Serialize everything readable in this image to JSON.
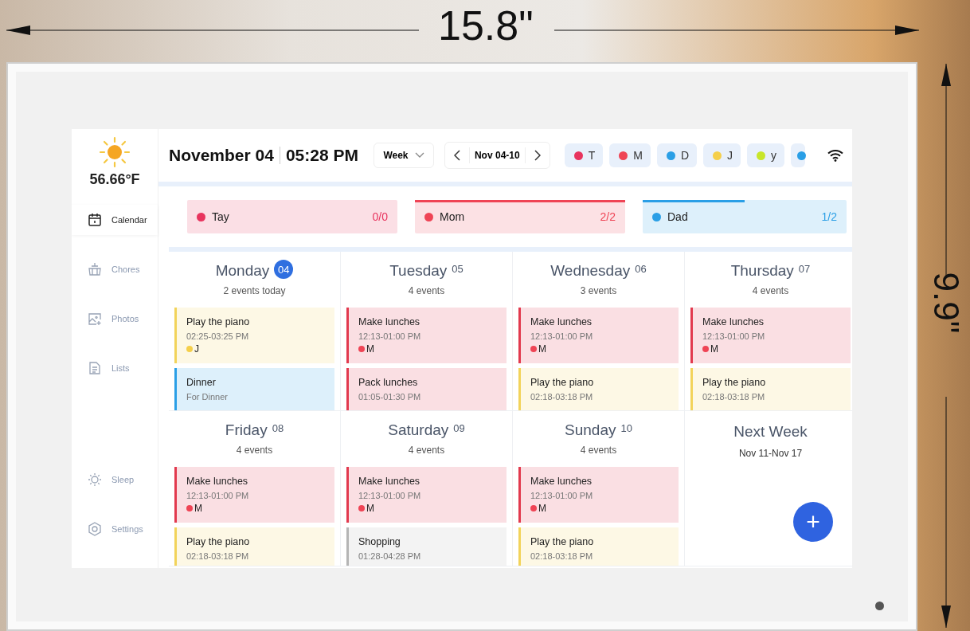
{
  "dimensions": {
    "width_label": "15.8\"",
    "height_label": "9.9\""
  },
  "sidebar": {
    "temperature": "56.66°F",
    "items": [
      {
        "kind": "calendar",
        "label": "Calendar",
        "selected": true
      },
      {
        "kind": "chores",
        "label": "Chores",
        "selected": false
      },
      {
        "kind": "photos",
        "label": "Photos",
        "selected": false
      },
      {
        "kind": "lists",
        "label": "Lists",
        "selected": false
      }
    ],
    "bottom_items": [
      {
        "kind": "sleep",
        "label": "Sleep",
        "selected": false
      },
      {
        "kind": "settings",
        "label": "Settings",
        "selected": false
      }
    ]
  },
  "header": {
    "date": "November 04",
    "time": "05:28 PM",
    "view": "Week",
    "range": "Nov 04-10",
    "members": [
      {
        "label": "T",
        "color": "#e8345e"
      },
      {
        "label": "M",
        "color": "#ef4455"
      },
      {
        "label": "D",
        "color": "#2a9fe6"
      },
      {
        "label": "J",
        "color": "#f5cf4a"
      },
      {
        "label": "y",
        "color": "#c8e62a"
      },
      {
        "color": "#2a9fe6"
      }
    ]
  },
  "progress": [
    {
      "name": "Tay",
      "color": "#e8345e",
      "count": "0/0",
      "level": 0
    },
    {
      "name": "Mom",
      "color": "#ef4455",
      "count": "2/2",
      "level": 1
    },
    {
      "name": "Dad",
      "color": "#2a9fe6",
      "count": "1/2",
      "level": 0.5
    }
  ],
  "days": [
    {
      "name": "Monday",
      "date": "04",
      "today": true,
      "summary": "2 events today",
      "events": [
        {
          "title": "Play the piano",
          "time": "02:25-03:25 PM",
          "color": "#f2d35a",
          "person": {
            "label": "J",
            "color": "#f5cf4a"
          }
        },
        {
          "title": "Dinner",
          "time": "For Dinner",
          "color": "#2a9fe6"
        }
      ]
    },
    {
      "name": "Tuesday",
      "date": "05",
      "today": false,
      "summary": "4 events",
      "events": [
        {
          "title": "Make lunches",
          "time": "12:13-01:00 PM",
          "color": "#e2394e",
          "person": {
            "label": "M",
            "color": "#ef4455"
          }
        },
        {
          "title": "Pack lunches",
          "time": "01:05-01:30 PM",
          "color": "#e2394e"
        }
      ]
    },
    {
      "name": "Wednesday",
      "date": "06",
      "today": false,
      "summary": "3 events",
      "events": [
        {
          "title": "Make lunches",
          "time": "12:13-01:00 PM",
          "color": "#e2394e",
          "person": {
            "label": "M",
            "color": "#ef4455"
          }
        },
        {
          "title": "Play the piano",
          "time": "02:18-03:18 PM",
          "color": "#f2d35a"
        }
      ]
    },
    {
      "name": "Thursday",
      "date": "07",
      "today": false,
      "summary": "4 events",
      "events": [
        {
          "title": "Make lunches",
          "time": "12:13-01:00 PM",
          "color": "#e2394e",
          "person": {
            "label": "M",
            "color": "#ef4455"
          }
        },
        {
          "title": "Play the piano",
          "time": "02:18-03:18 PM",
          "color": "#f2d35a"
        }
      ]
    },
    {
      "name": "Friday",
      "date": "08",
      "today": false,
      "summary": "4 events",
      "events": [
        {
          "title": "Make lunches",
          "time": "12:13-01:00 PM",
          "color": "#e2394e",
          "person": {
            "label": "M",
            "color": "#ef4455"
          }
        },
        {
          "title": "Play the piano",
          "time": "02:18-03:18 PM",
          "color": "#f2d35a"
        }
      ]
    },
    {
      "name": "Saturday",
      "date": "09",
      "today": false,
      "summary": "4 events",
      "events": [
        {
          "title": "Make lunches",
          "time": "12:13-01:00 PM",
          "color": "#e2394e",
          "person": {
            "label": "M",
            "color": "#ef4455"
          }
        },
        {
          "title": "Shopping",
          "time": "01:28-04:28 PM",
          "color": "#b5b5b5"
        }
      ]
    },
    {
      "name": "Sunday",
      "date": "10",
      "today": false,
      "summary": "4 events",
      "events": [
        {
          "title": "Make lunches",
          "time": "12:13-01:00 PM",
          "color": "#e2394e",
          "person": {
            "label": "M",
            "color": "#ef4455"
          }
        },
        {
          "title": "Play the piano",
          "time": "02:18-03:18 PM",
          "color": "#f2d35a"
        }
      ]
    }
  ],
  "next_week": {
    "title": "Next Week",
    "range": "Nov 11-Nov 17"
  },
  "add_button": {
    "label": "+"
  }
}
